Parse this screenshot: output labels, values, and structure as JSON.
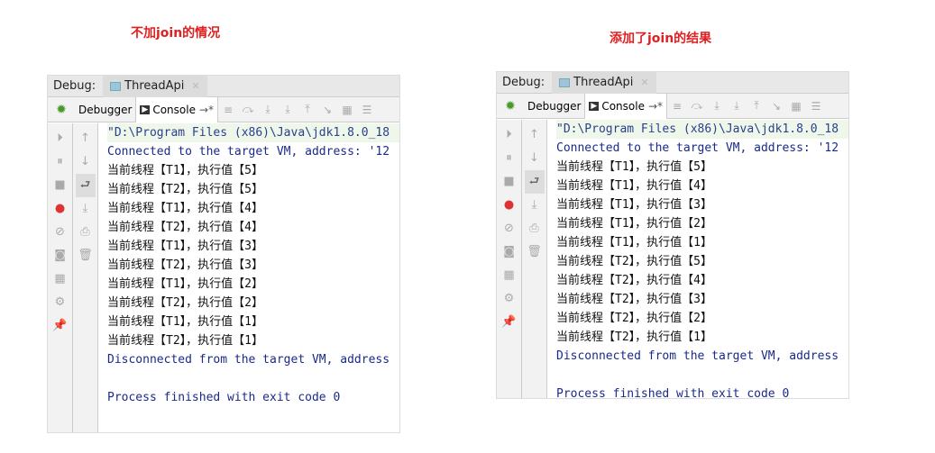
{
  "titles": [
    "不加join的情况",
    "添加了join的结果"
  ],
  "colors": {
    "title": "#e02020",
    "system_text": "#1a2a8a"
  },
  "debug_label": "Debug:",
  "run_tab": "ThreadApi",
  "tabs": {
    "debugger": "Debugger",
    "console": "Console"
  },
  "panels": [
    {
      "lines": [
        {
          "t": "\"D:\\Program Files (x86)\\Java\\jdk1.8.0_18",
          "k": "cmd"
        },
        {
          "t": "Connected to the target VM, address: '12",
          "k": "sys"
        },
        {
          "t": "当前线程【T1】，执行值【5】",
          "k": "out"
        },
        {
          "t": "当前线程【T2】，执行值【5】",
          "k": "out"
        },
        {
          "t": "当前线程【T1】，执行值【4】",
          "k": "out"
        },
        {
          "t": "当前线程【T2】，执行值【4】",
          "k": "out"
        },
        {
          "t": "当前线程【T1】，执行值【3】",
          "k": "out"
        },
        {
          "t": "当前线程【T2】，执行值【3】",
          "k": "out"
        },
        {
          "t": "当前线程【T1】，执行值【2】",
          "k": "out"
        },
        {
          "t": "当前线程【T2】，执行值【2】",
          "k": "out"
        },
        {
          "t": "当前线程【T1】，执行值【1】",
          "k": "out"
        },
        {
          "t": "当前线程【T2】，执行值【1】",
          "k": "out"
        },
        {
          "t": "Disconnected from the target VM, address",
          "k": "sys"
        },
        {
          "t": "",
          "k": "out"
        },
        {
          "t": "Process finished with exit code 0",
          "k": "sys"
        }
      ]
    },
    {
      "lines": [
        {
          "t": "\"D:\\Program Files (x86)\\Java\\jdk1.8.0_18",
          "k": "cmd"
        },
        {
          "t": "Connected to the target VM, address: '12",
          "k": "sys"
        },
        {
          "t": "当前线程【T1】，执行值【5】",
          "k": "out"
        },
        {
          "t": "当前线程【T1】，执行值【4】",
          "k": "out"
        },
        {
          "t": "当前线程【T1】，执行值【3】",
          "k": "out"
        },
        {
          "t": "当前线程【T1】，执行值【2】",
          "k": "out"
        },
        {
          "t": "当前线程【T1】，执行值【1】",
          "k": "out"
        },
        {
          "t": "当前线程【T2】，执行值【5】",
          "k": "out"
        },
        {
          "t": "当前线程【T2】，执行值【4】",
          "k": "out"
        },
        {
          "t": "当前线程【T2】，执行值【3】",
          "k": "out"
        },
        {
          "t": "当前线程【T2】，执行值【2】",
          "k": "out"
        },
        {
          "t": "当前线程【T2】，执行值【1】",
          "k": "out"
        },
        {
          "t": "Disconnected from the target VM, address",
          "k": "sys"
        },
        {
          "t": "",
          "k": "out"
        },
        {
          "t": "Process finished with exit code 0",
          "k": "sys"
        }
      ]
    }
  ]
}
